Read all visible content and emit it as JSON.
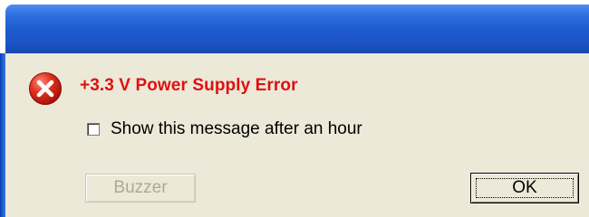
{
  "dialog": {
    "error_title": "+3.3 V Power Supply Error",
    "icon": "error-circle-x-icon",
    "checkbox": {
      "label": "Show this message after an hour",
      "checked": false
    },
    "buttons": {
      "buzzer_label": "Buzzer",
      "buzzer_enabled": false,
      "ok_label": "OK"
    },
    "colors": {
      "title_bar": "#1f5bd0",
      "dialog_background": "#ece9d8",
      "error_text": "#e01010",
      "error_icon": "#d8261c",
      "disabled_text": "#aca899"
    }
  }
}
